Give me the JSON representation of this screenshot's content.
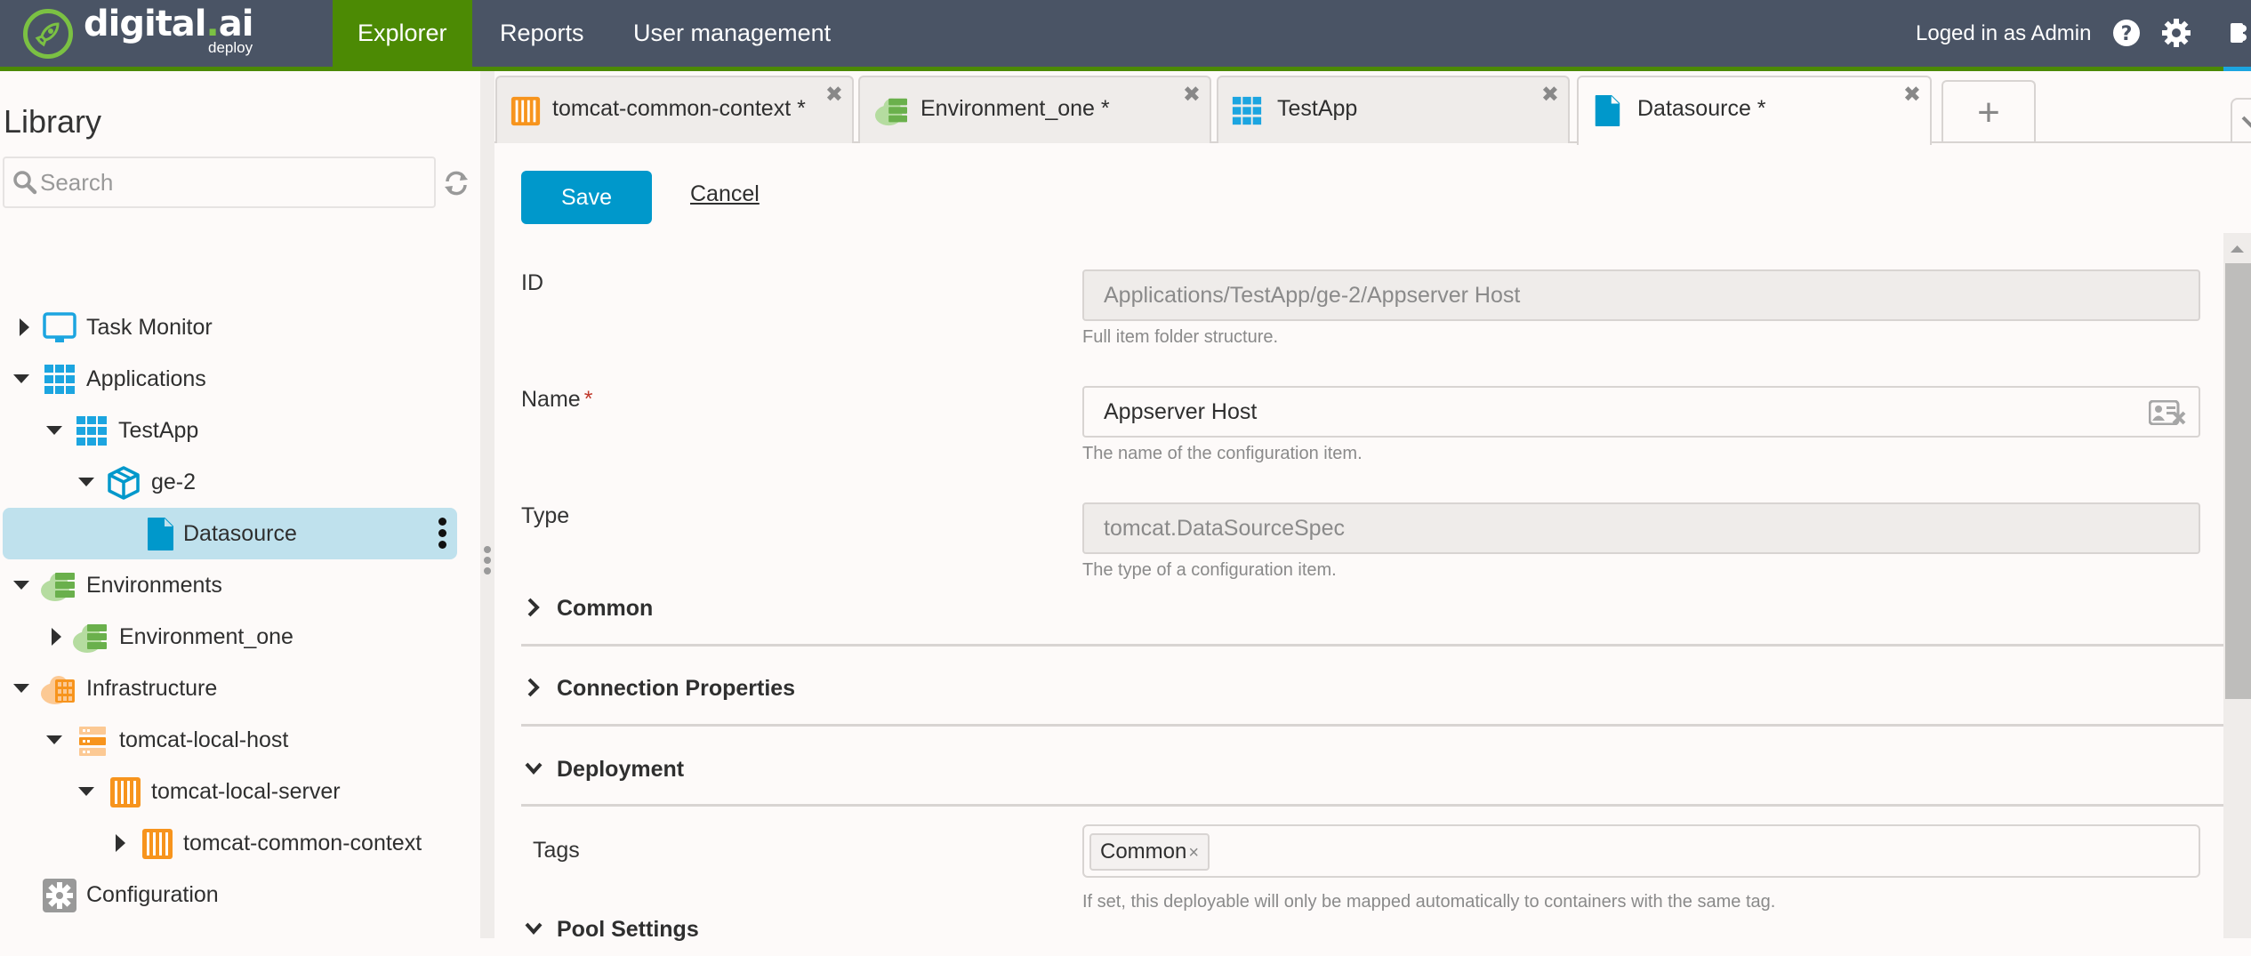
{
  "header": {
    "logo_text_1": "digital",
    "logo_dot": ".",
    "logo_text_2": "ai",
    "logo_sub": "deploy",
    "nav": [
      {
        "label": "Explorer",
        "active": true
      },
      {
        "label": "Reports",
        "active": false
      },
      {
        "label": "User management",
        "active": false
      }
    ],
    "user_label": "Loged in as Admin",
    "icons": [
      "help-icon",
      "settings-icon",
      "plugin-icon"
    ]
  },
  "sidebar": {
    "title": "Library",
    "search_placeholder": "Search",
    "tree": [
      {
        "label": "Task Monitor",
        "icon": "monitor-icon",
        "caret": "right",
        "level": 0
      },
      {
        "label": "Applications",
        "icon": "applications-icon",
        "caret": "down",
        "level": 0
      },
      {
        "label": "TestApp",
        "icon": "application-icon",
        "caret": "down",
        "level": 1
      },
      {
        "label": "ge-2",
        "icon": "package-icon",
        "caret": "down",
        "level": 2
      },
      {
        "label": "Datasource",
        "icon": "file-icon",
        "caret": "none",
        "level": 3,
        "selected": true
      },
      {
        "label": "Environments",
        "icon": "environments-icon",
        "caret": "down",
        "level": 0
      },
      {
        "label": "Environment_one",
        "icon": "environment-icon",
        "caret": "right",
        "level": 1
      },
      {
        "label": "Infrastructure",
        "icon": "infrastructure-icon",
        "caret": "down",
        "level": 0
      },
      {
        "label": "tomcat-local-host",
        "icon": "host-icon",
        "caret": "down",
        "level": 1
      },
      {
        "label": "tomcat-local-server",
        "icon": "container-icon",
        "caret": "down",
        "level": 2
      },
      {
        "label": "tomcat-common-context",
        "icon": "container-icon",
        "caret": "right",
        "level": 3
      },
      {
        "label": "Configuration",
        "icon": "configuration-icon",
        "caret": "none",
        "level": 0
      }
    ]
  },
  "tabs": [
    {
      "label": "tomcat-common-context *",
      "icon": "container-icon",
      "active": false
    },
    {
      "label": "Environment_one *",
      "icon": "environment-icon",
      "active": false
    },
    {
      "label": "TestApp",
      "icon": "application-icon",
      "active": false
    },
    {
      "label": "Datasource *",
      "icon": "file-icon",
      "active": true
    }
  ],
  "add_tab_label": "+",
  "form": {
    "save_label": "Save",
    "cancel_label": "Cancel",
    "id": {
      "label": "ID",
      "value": "Applications/TestApp/ge-2/Appserver Host",
      "hint": "Full item folder structure."
    },
    "name": {
      "label": "Name",
      "required_mark": "*",
      "value": "Appserver Host",
      "hint": "The name of the configuration item."
    },
    "type": {
      "label": "Type",
      "value": "tomcat.DataSourceSpec",
      "hint": "The type of a configuration item."
    },
    "sections": [
      {
        "title": "Common",
        "expanded": false
      },
      {
        "title": "Connection Properties",
        "expanded": false
      },
      {
        "title": "Deployment",
        "expanded": true
      },
      {
        "title": "Pool Settings",
        "expanded": true
      }
    ],
    "tags": {
      "label": "Tags",
      "values": [
        "Common"
      ],
      "remove_glyph": "×",
      "hint": "If set, this deployable will only be mapped automatically to containers with the same tag."
    }
  },
  "colors": {
    "header_bg": "#4a5465",
    "brand_green": "#4c8a04",
    "accent_blue": "#0098cb",
    "selected_row": "#bfe1ed",
    "orange": "#f7941d",
    "env_green": "#6ab04c"
  }
}
